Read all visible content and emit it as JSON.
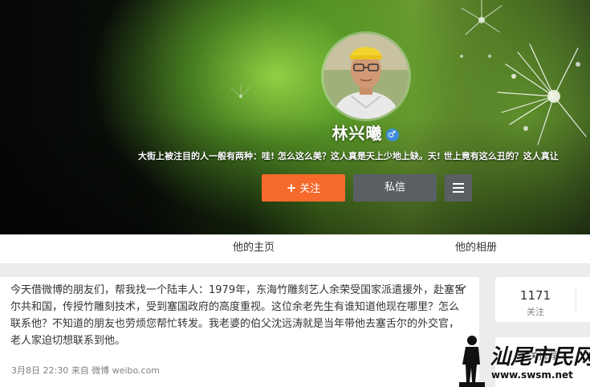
{
  "profile": {
    "name": "林兴曦",
    "gender_symbol": "♂",
    "bio": "大街上被注目的人一般有两种：哇! 怎么这么美？这人真是天上少地上缺。天! 世上竟有这么丑的？这人真让"
  },
  "actions": {
    "follow_label": "关注",
    "follow_plus": "+",
    "message_label": "私信",
    "more_icon": "menu-icon"
  },
  "tabs": [
    {
      "label": "他的主页"
    },
    {
      "label": "他的相册"
    }
  ],
  "post": {
    "text": "今天借微博的朋友们，帮我找一个陆丰人：1979年，东海竹雕刻艺人余荣受国家派遣援外，赴塞舌尔共和国，传授竹雕刻技术，受到塞国政府的高度重视。这位余老先生有谁知道他现在哪里？怎么联系他？不知道的朋友也劳烦您帮忙转发。我老婆的伯父沈远涛就是当年带他去塞舌尔的外交官，老人家迫切想联系到他。",
    "meta": "3月8日 22:30 来自 微博 weibo.com"
  },
  "stats": {
    "following_count": "1171",
    "following_label": "关注"
  },
  "sidebar": {
    "related_title": "相关推荐"
  },
  "watermark": {
    "brand": "汕尾市民网",
    "url": "www.swsm.net"
  },
  "colors": {
    "follow_button": "#f5692c",
    "secondary_button": "#5a5f64",
    "gender_badge": "#3c8ddc"
  }
}
